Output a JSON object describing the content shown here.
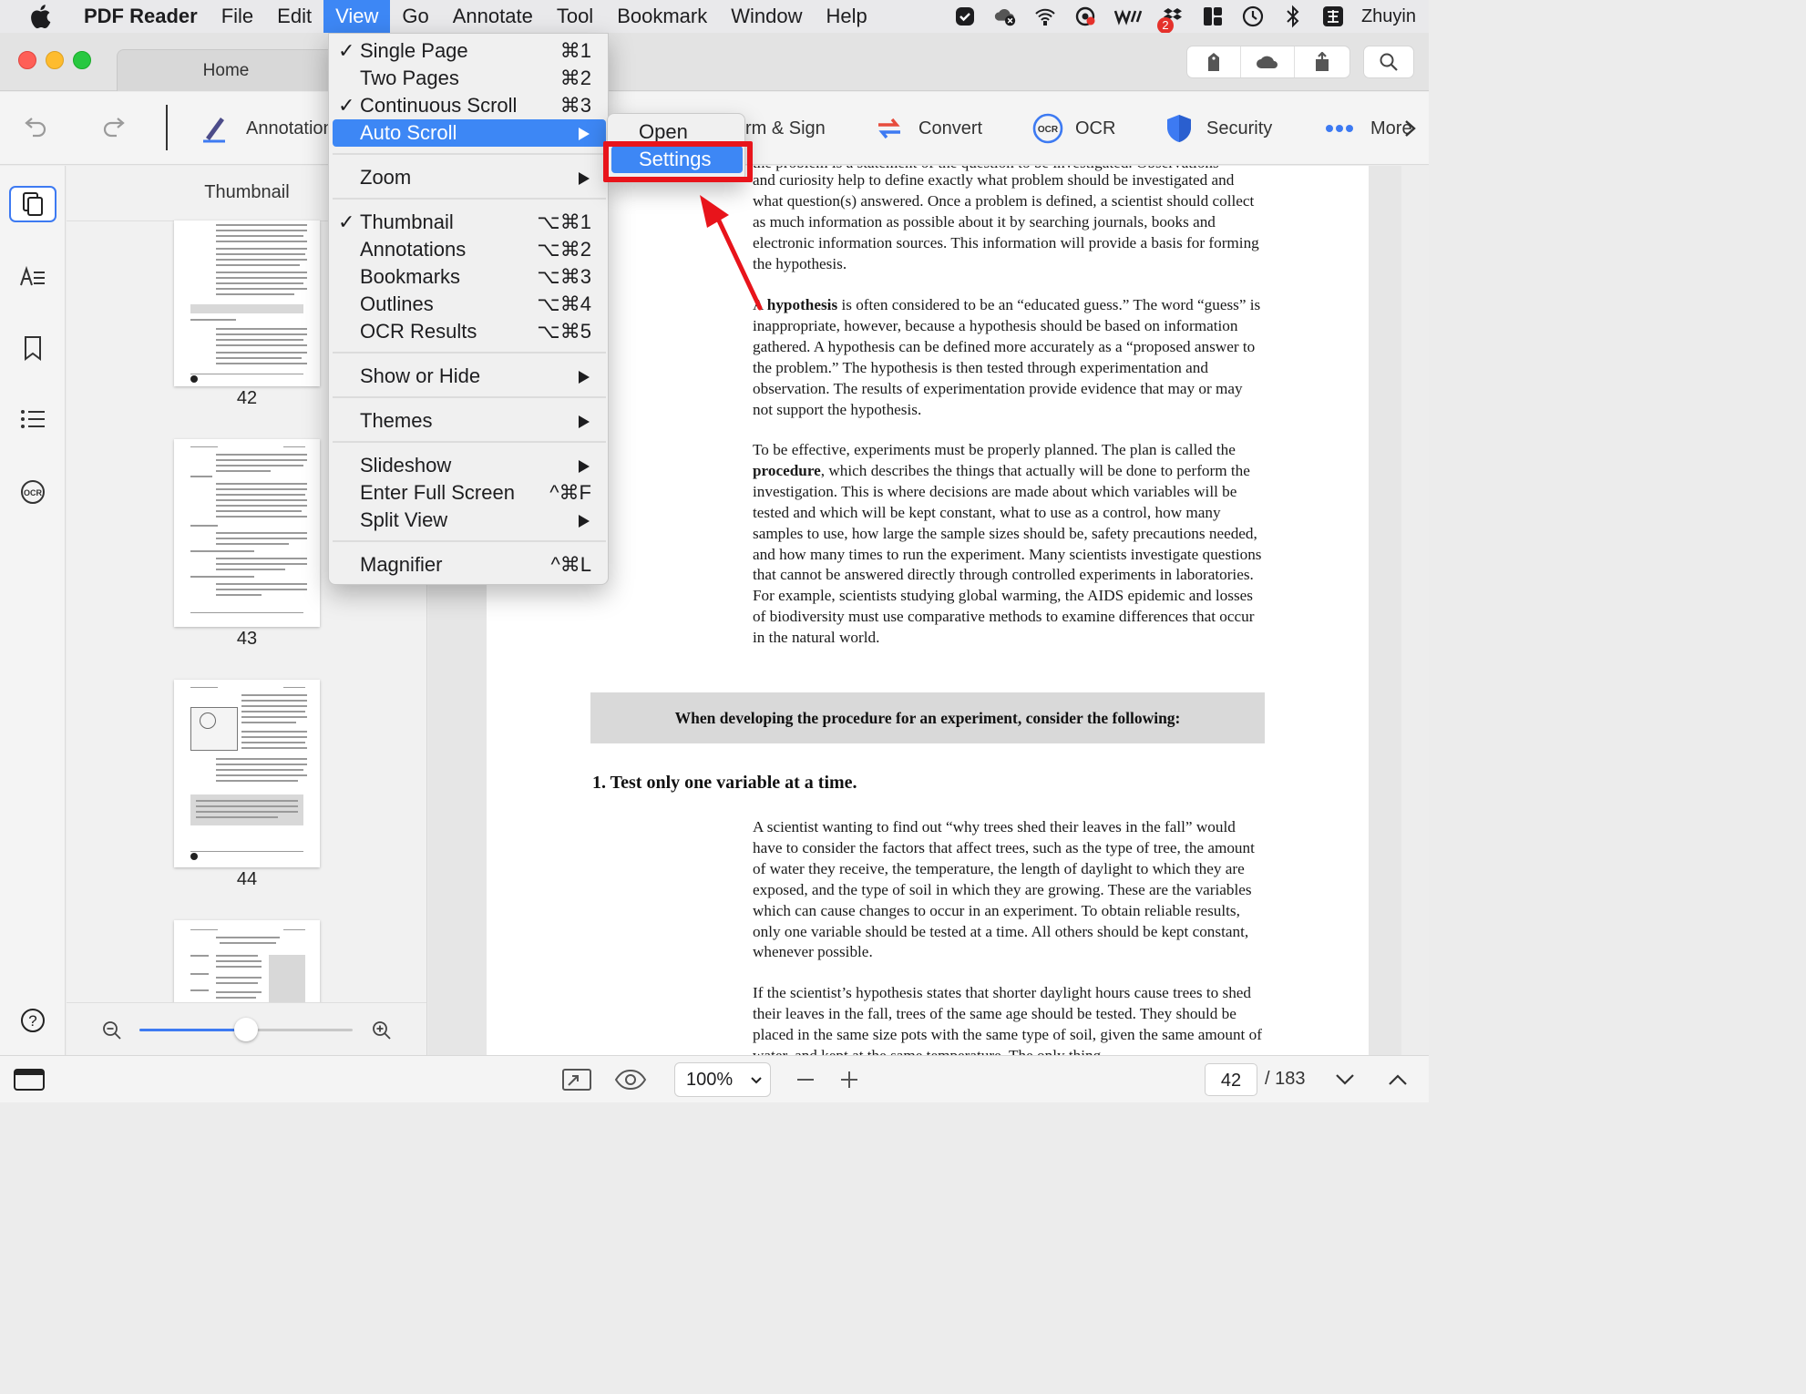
{
  "menubar": {
    "app": "PDF Reader",
    "items": [
      "File",
      "Edit",
      "View",
      "Go",
      "Annotate",
      "Tool",
      "Bookmark",
      "Window",
      "Help"
    ],
    "active": "View",
    "user": "Zhuyin",
    "badge": "2"
  },
  "window": {
    "tab": "Home"
  },
  "toolbar": {
    "annotation": "Annotation",
    "form_sign": "rm & Sign",
    "convert": "Convert",
    "ocr": "OCR",
    "security": "Security",
    "more": "More"
  },
  "sidebar": {
    "title": "Thumbnail",
    "pages": [
      "42",
      "43",
      "44"
    ]
  },
  "view_menu": {
    "single_page": {
      "label": "Single Page",
      "shortcut": "⌘1",
      "checked": true
    },
    "two_pages": {
      "label": "Two Pages",
      "shortcut": "⌘2"
    },
    "continuous_scroll": {
      "label": "Continuous Scroll",
      "shortcut": "⌘3",
      "checked": true
    },
    "auto_scroll": {
      "label": "Auto Scroll"
    },
    "zoom": {
      "label": "Zoom"
    },
    "thumbnail": {
      "label": "Thumbnail",
      "shortcut": "⌥⌘1",
      "checked": true
    },
    "annotations": {
      "label": "Annotations",
      "shortcut": "⌥⌘2"
    },
    "bookmarks": {
      "label": "Bookmarks",
      "shortcut": "⌥⌘3"
    },
    "outlines": {
      "label": "Outlines",
      "shortcut": "⌥⌘4"
    },
    "ocr_results": {
      "label": "OCR Results",
      "shortcut": "⌥⌘5"
    },
    "show_or_hide": {
      "label": "Show or Hide"
    },
    "themes": {
      "label": "Themes"
    },
    "slideshow": {
      "label": "Slideshow"
    },
    "full_screen": {
      "label": "Enter Full Screen",
      "shortcut": "^⌘F"
    },
    "split_view": {
      "label": "Split View"
    },
    "magnifier": {
      "label": "Magnifier",
      "shortcut": "^⌘L"
    },
    "check_mark": "✓"
  },
  "auto_scroll_submenu": {
    "open": "Open",
    "settings": "Settings"
  },
  "document": {
    "p1_top": "the problem is a statement of the question to be investigated. Observations",
    "p1": "and curiosity help to define exactly what problem should be investigated and what question(s) answered. Once a problem is defined, a scientist should collect as much information as possible about it by searching journals, books and electronic information sources. This information will provide a basis for forming the hypothesis.",
    "p2_a": "A ",
    "p2_bold": "hypothesis",
    "p2_b": " is often considered to be an “educated guess.” The word “guess” is inappropriate, however, because a hypothesis should be based on information gathered. A hypothesis can be defined more accurately as a “proposed answer to the problem.” The hypothesis is then tested through experimentation and observation. The results of experimentation provide evidence that may or may not support the hypothesis.",
    "p3_a": "To be effective, experiments must be properly planned. The plan is called the ",
    "p3_bold": "procedure",
    "p3_b": ", which describes the things that actually will be done to perform the investigation. This is where decisions are made about which variables will be tested and which will be kept constant, what to use as a control, how many samples to use, how large the sample sizes should be, safety precautions needed, and how many times to run the experiment. Many scientists investigate questions that cannot be answered directly through controlled experiments in laboratories. For example, scientists studying global warming, the AIDS epidemic and losses of biodiversity must use comparative methods to examine differences that occur in the natural world.",
    "callout": "When developing the procedure for an experiment, consider the following:",
    "heading": "1.  Test only one variable at a time.",
    "p4": "A scientist wanting to find out “why trees shed their leaves in the fall” would have to consider the factors that affect trees, such as the type of tree, the amount of water they receive, the temperature, the length of daylight to which they are exposed, and the type of soil in which they are growing. These are the variables which can cause changes to occur in an experiment. To obtain reliable results, only one variable should be tested at a time. All others should be kept constant, whenever possible.",
    "p5": "If the scientist’s hypothesis states that shorter daylight hours cause trees to shed their leaves in the fall, trees of the same age should be tested. They should be placed in the same size pots with the same type of soil, given the same amount of water, and kept at the same temperature. The only thing"
  },
  "statusbar": {
    "zoom": "100%",
    "current_page": "42",
    "total_pages": "/ 183"
  },
  "colors": {
    "accent": "#3d87f5",
    "highlight_box": "#e8141b",
    "convert_red": "#e74c3c",
    "convert_blue": "#3d7af2"
  }
}
